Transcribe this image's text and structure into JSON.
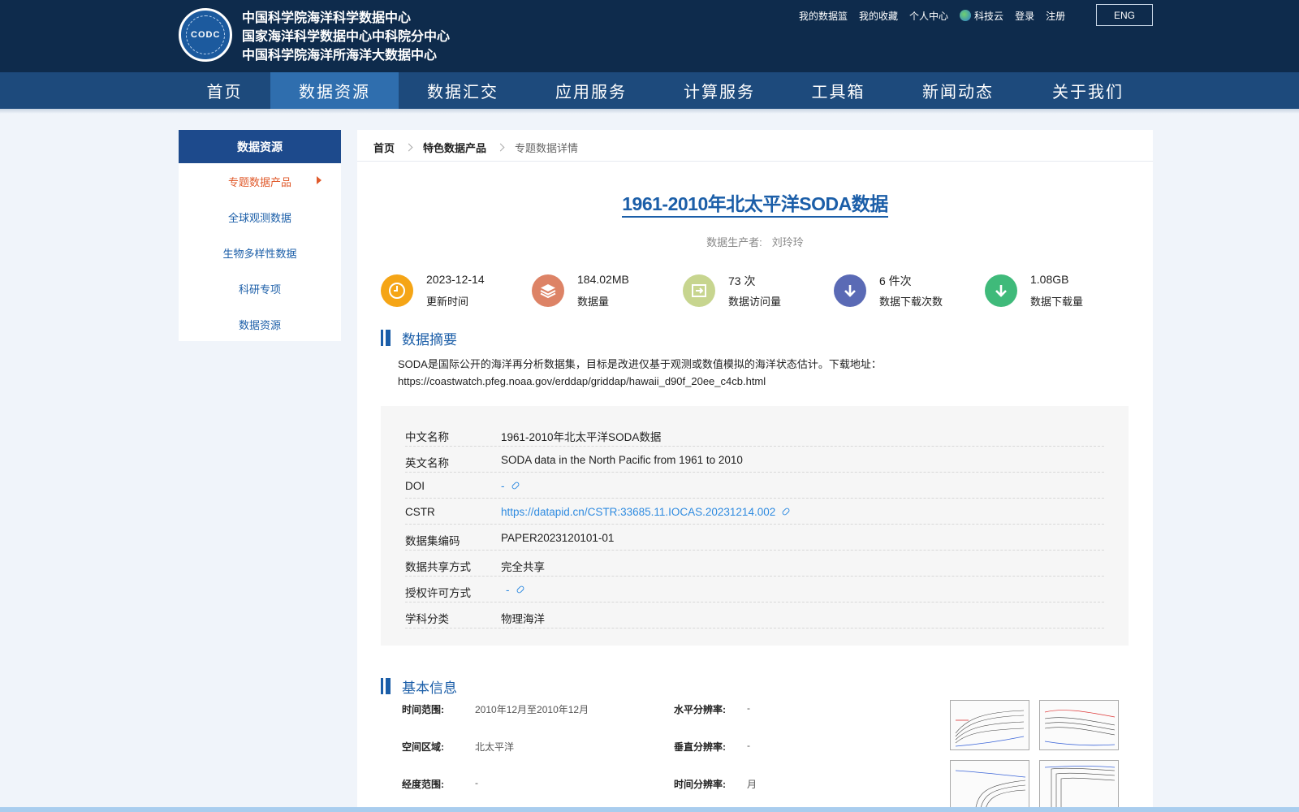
{
  "header": {
    "logo_text": "CODC",
    "org_names": [
      "中国科学院海洋科学数据中心",
      "国家海洋科学数据中心中科院分中心",
      "中国科学院海洋所海洋大数据中心"
    ],
    "top_links": [
      "我的数据篮",
      "我的收藏",
      "个人中心",
      "科技云",
      "登录",
      "注册"
    ],
    "lang_button": "ENG"
  },
  "nav": {
    "items": [
      "首页",
      "数据资源",
      "数据汇交",
      "应用服务",
      "计算服务",
      "工具箱",
      "新闻动态",
      "关于我们"
    ],
    "active_index": 1
  },
  "sidebar": {
    "header": "数据资源",
    "items": [
      "专题数据产品",
      "全球观测数据",
      "生物多样性数据",
      "科研专项",
      "数据资源"
    ],
    "active_index": 0
  },
  "breadcrumb": [
    "首页",
    "特色数据产品",
    "专题数据详情"
  ],
  "dataset": {
    "title": "1961-2010年北太平洋SODA数据",
    "producer_label": "数据生产者:",
    "producer_value": "刘玲玲"
  },
  "stats": [
    {
      "value": "2023-12-14",
      "label": "更新时间",
      "icon": "clock-icon",
      "color": "#f5a516"
    },
    {
      "value": "184.02MB",
      "label": "数据量",
      "icon": "layers-icon",
      "color": "#dd8366"
    },
    {
      "value": "73 次",
      "label": "数据访问量",
      "icon": "visit-icon",
      "color": "#c7d58f"
    },
    {
      "value": "6 件次",
      "label": "数据下载次数",
      "icon": "download-icon",
      "color": "#5a6ab5"
    },
    {
      "value": "1.08GB",
      "label": "数据下载量",
      "icon": "download-volume-icon",
      "color": "#3fba7a"
    }
  ],
  "abstract": {
    "heading": "数据摘要",
    "text": "SODA是国际公开的海洋再分析数据集，目标是改进仅基于观测或数值模拟的海洋状态估计。下载地址：https://coastwatch.pfeg.noaa.gov/erddap/griddap/hawaii_d90f_20ee_c4cb.html"
  },
  "metadata": [
    {
      "key": "中文名称",
      "value": "1961-2010年北太平洋SODA数据"
    },
    {
      "key": "英文名称",
      "value": "SODA data in the North Pacific from 1961 to 2010"
    },
    {
      "key": "DOI",
      "value": "-",
      "link": true
    },
    {
      "key": "CSTR",
      "value": "https://datapid.cn/CSTR:33685.11.IOCAS.20231214.002",
      "link": true
    },
    {
      "key": "数据集编码",
      "value": "PAPER2023120101-01"
    },
    {
      "key": "数据共享方式",
      "value": "完全共享"
    },
    {
      "key": "授权许可方式",
      "value": "-",
      "link": true
    },
    {
      "key": "学科分类",
      "value": "物理海洋"
    }
  ],
  "basic_info": {
    "heading": "基本信息",
    "left": [
      {
        "key": "时间范围:",
        "value": "2010年12月至2010年12月"
      },
      {
        "key": "空间区域:",
        "value": "北太平洋"
      },
      {
        "key": "经度范围:",
        "value": "-"
      }
    ],
    "right": [
      {
        "key": "水平分辨率:",
        "value": "-"
      },
      {
        "key": "垂直分辨率:",
        "value": "-"
      },
      {
        "key": "时间分辨率:",
        "value": "月"
      }
    ]
  },
  "colors": {
    "header_bg": "#0e2b4c",
    "nav_bg": "#1d4a7c",
    "nav_active": "#2f6eae",
    "accent": "#1b5ea8",
    "sidebar_active": "#e05a2b",
    "link": "#2f8be0"
  }
}
